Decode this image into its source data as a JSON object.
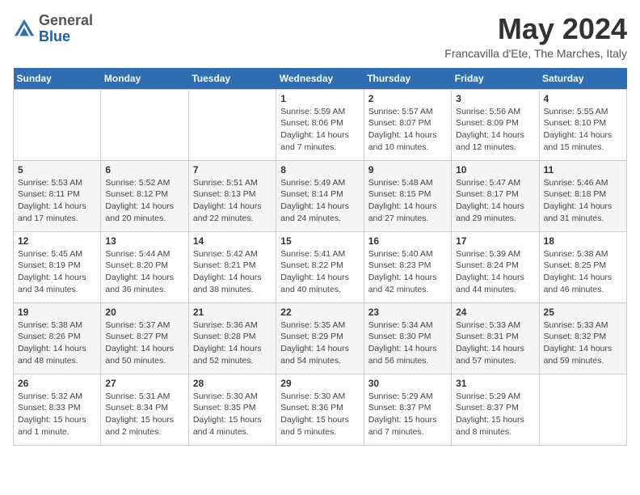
{
  "header": {
    "logo_line1": "General",
    "logo_line2": "Blue",
    "month_title": "May 2024",
    "subtitle": "Francavilla d'Ete, The Marches, Italy"
  },
  "days_of_week": [
    "Sunday",
    "Monday",
    "Tuesday",
    "Wednesday",
    "Thursday",
    "Friday",
    "Saturday"
  ],
  "weeks": [
    [
      {
        "day": "",
        "info": ""
      },
      {
        "day": "",
        "info": ""
      },
      {
        "day": "",
        "info": ""
      },
      {
        "day": "1",
        "info": "Sunrise: 5:59 AM\nSunset: 8:06 PM\nDaylight: 14 hours\nand 7 minutes."
      },
      {
        "day": "2",
        "info": "Sunrise: 5:57 AM\nSunset: 8:07 PM\nDaylight: 14 hours\nand 10 minutes."
      },
      {
        "day": "3",
        "info": "Sunrise: 5:56 AM\nSunset: 8:09 PM\nDaylight: 14 hours\nand 12 minutes."
      },
      {
        "day": "4",
        "info": "Sunrise: 5:55 AM\nSunset: 8:10 PM\nDaylight: 14 hours\nand 15 minutes."
      }
    ],
    [
      {
        "day": "5",
        "info": "Sunrise: 5:53 AM\nSunset: 8:11 PM\nDaylight: 14 hours\nand 17 minutes."
      },
      {
        "day": "6",
        "info": "Sunrise: 5:52 AM\nSunset: 8:12 PM\nDaylight: 14 hours\nand 20 minutes."
      },
      {
        "day": "7",
        "info": "Sunrise: 5:51 AM\nSunset: 8:13 PM\nDaylight: 14 hours\nand 22 minutes."
      },
      {
        "day": "8",
        "info": "Sunrise: 5:49 AM\nSunset: 8:14 PM\nDaylight: 14 hours\nand 24 minutes."
      },
      {
        "day": "9",
        "info": "Sunrise: 5:48 AM\nSunset: 8:15 PM\nDaylight: 14 hours\nand 27 minutes."
      },
      {
        "day": "10",
        "info": "Sunrise: 5:47 AM\nSunset: 8:17 PM\nDaylight: 14 hours\nand 29 minutes."
      },
      {
        "day": "11",
        "info": "Sunrise: 5:46 AM\nSunset: 8:18 PM\nDaylight: 14 hours\nand 31 minutes."
      }
    ],
    [
      {
        "day": "12",
        "info": "Sunrise: 5:45 AM\nSunset: 8:19 PM\nDaylight: 14 hours\nand 34 minutes."
      },
      {
        "day": "13",
        "info": "Sunrise: 5:44 AM\nSunset: 8:20 PM\nDaylight: 14 hours\nand 36 minutes."
      },
      {
        "day": "14",
        "info": "Sunrise: 5:42 AM\nSunset: 8:21 PM\nDaylight: 14 hours\nand 38 minutes."
      },
      {
        "day": "15",
        "info": "Sunrise: 5:41 AM\nSunset: 8:22 PM\nDaylight: 14 hours\nand 40 minutes."
      },
      {
        "day": "16",
        "info": "Sunrise: 5:40 AM\nSunset: 8:23 PM\nDaylight: 14 hours\nand 42 minutes."
      },
      {
        "day": "17",
        "info": "Sunrise: 5:39 AM\nSunset: 8:24 PM\nDaylight: 14 hours\nand 44 minutes."
      },
      {
        "day": "18",
        "info": "Sunrise: 5:38 AM\nSunset: 8:25 PM\nDaylight: 14 hours\nand 46 minutes."
      }
    ],
    [
      {
        "day": "19",
        "info": "Sunrise: 5:38 AM\nSunset: 8:26 PM\nDaylight: 14 hours\nand 48 minutes."
      },
      {
        "day": "20",
        "info": "Sunrise: 5:37 AM\nSunset: 8:27 PM\nDaylight: 14 hours\nand 50 minutes."
      },
      {
        "day": "21",
        "info": "Sunrise: 5:36 AM\nSunset: 8:28 PM\nDaylight: 14 hours\nand 52 minutes."
      },
      {
        "day": "22",
        "info": "Sunrise: 5:35 AM\nSunset: 8:29 PM\nDaylight: 14 hours\nand 54 minutes."
      },
      {
        "day": "23",
        "info": "Sunrise: 5:34 AM\nSunset: 8:30 PM\nDaylight: 14 hours\nand 56 minutes."
      },
      {
        "day": "24",
        "info": "Sunrise: 5:33 AM\nSunset: 8:31 PM\nDaylight: 14 hours\nand 57 minutes."
      },
      {
        "day": "25",
        "info": "Sunrise: 5:33 AM\nSunset: 8:32 PM\nDaylight: 14 hours\nand 59 minutes."
      }
    ],
    [
      {
        "day": "26",
        "info": "Sunrise: 5:32 AM\nSunset: 8:33 PM\nDaylight: 15 hours\nand 1 minute."
      },
      {
        "day": "27",
        "info": "Sunrise: 5:31 AM\nSunset: 8:34 PM\nDaylight: 15 hours\nand 2 minutes."
      },
      {
        "day": "28",
        "info": "Sunrise: 5:30 AM\nSunset: 8:35 PM\nDaylight: 15 hours\nand 4 minutes."
      },
      {
        "day": "29",
        "info": "Sunrise: 5:30 AM\nSunset: 8:36 PM\nDaylight: 15 hours\nand 5 minutes."
      },
      {
        "day": "30",
        "info": "Sunrise: 5:29 AM\nSunset: 8:37 PM\nDaylight: 15 hours\nand 7 minutes."
      },
      {
        "day": "31",
        "info": "Sunrise: 5:29 AM\nSunset: 8:37 PM\nDaylight: 15 hours\nand 8 minutes."
      },
      {
        "day": "",
        "info": ""
      }
    ]
  ]
}
